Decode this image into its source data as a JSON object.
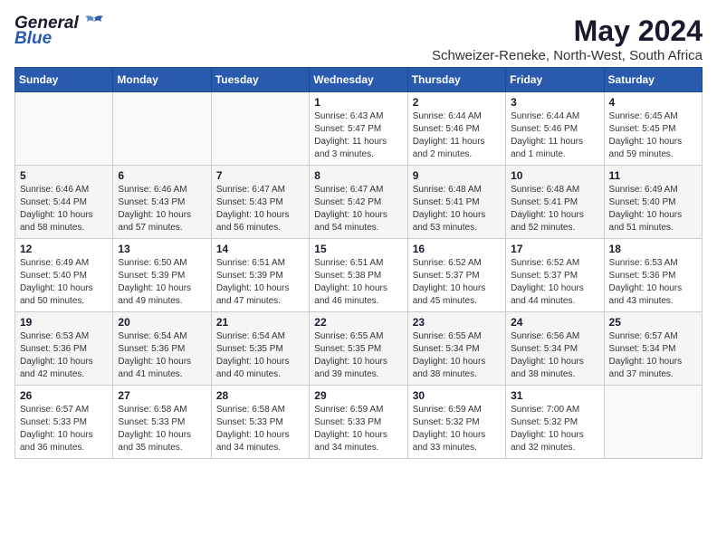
{
  "logo": {
    "general": "General",
    "blue": "Blue"
  },
  "title": "May 2024",
  "subtitle": "Schweizer-Reneke, North-West, South Africa",
  "days_of_week": [
    "Sunday",
    "Monday",
    "Tuesday",
    "Wednesday",
    "Thursday",
    "Friday",
    "Saturday"
  ],
  "weeks": [
    {
      "cells": [
        {
          "day": null,
          "info": null
        },
        {
          "day": null,
          "info": null
        },
        {
          "day": null,
          "info": null
        },
        {
          "day": "1",
          "info": "Sunrise: 6:43 AM\nSunset: 5:47 PM\nDaylight: 11 hours\nand 3 minutes."
        },
        {
          "day": "2",
          "info": "Sunrise: 6:44 AM\nSunset: 5:46 PM\nDaylight: 11 hours\nand 2 minutes."
        },
        {
          "day": "3",
          "info": "Sunrise: 6:44 AM\nSunset: 5:46 PM\nDaylight: 11 hours\nand 1 minute."
        },
        {
          "day": "4",
          "info": "Sunrise: 6:45 AM\nSunset: 5:45 PM\nDaylight: 10 hours\nand 59 minutes."
        }
      ],
      "alt": false
    },
    {
      "cells": [
        {
          "day": "5",
          "info": "Sunrise: 6:46 AM\nSunset: 5:44 PM\nDaylight: 10 hours\nand 58 minutes."
        },
        {
          "day": "6",
          "info": "Sunrise: 6:46 AM\nSunset: 5:43 PM\nDaylight: 10 hours\nand 57 minutes."
        },
        {
          "day": "7",
          "info": "Sunrise: 6:47 AM\nSunset: 5:43 PM\nDaylight: 10 hours\nand 56 minutes."
        },
        {
          "day": "8",
          "info": "Sunrise: 6:47 AM\nSunset: 5:42 PM\nDaylight: 10 hours\nand 54 minutes."
        },
        {
          "day": "9",
          "info": "Sunrise: 6:48 AM\nSunset: 5:41 PM\nDaylight: 10 hours\nand 53 minutes."
        },
        {
          "day": "10",
          "info": "Sunrise: 6:48 AM\nSunset: 5:41 PM\nDaylight: 10 hours\nand 52 minutes."
        },
        {
          "day": "11",
          "info": "Sunrise: 6:49 AM\nSunset: 5:40 PM\nDaylight: 10 hours\nand 51 minutes."
        }
      ],
      "alt": true
    },
    {
      "cells": [
        {
          "day": "12",
          "info": "Sunrise: 6:49 AM\nSunset: 5:40 PM\nDaylight: 10 hours\nand 50 minutes."
        },
        {
          "day": "13",
          "info": "Sunrise: 6:50 AM\nSunset: 5:39 PM\nDaylight: 10 hours\nand 49 minutes."
        },
        {
          "day": "14",
          "info": "Sunrise: 6:51 AM\nSunset: 5:39 PM\nDaylight: 10 hours\nand 47 minutes."
        },
        {
          "day": "15",
          "info": "Sunrise: 6:51 AM\nSunset: 5:38 PM\nDaylight: 10 hours\nand 46 minutes."
        },
        {
          "day": "16",
          "info": "Sunrise: 6:52 AM\nSunset: 5:37 PM\nDaylight: 10 hours\nand 45 minutes."
        },
        {
          "day": "17",
          "info": "Sunrise: 6:52 AM\nSunset: 5:37 PM\nDaylight: 10 hours\nand 44 minutes."
        },
        {
          "day": "18",
          "info": "Sunrise: 6:53 AM\nSunset: 5:36 PM\nDaylight: 10 hours\nand 43 minutes."
        }
      ],
      "alt": false
    },
    {
      "cells": [
        {
          "day": "19",
          "info": "Sunrise: 6:53 AM\nSunset: 5:36 PM\nDaylight: 10 hours\nand 42 minutes."
        },
        {
          "day": "20",
          "info": "Sunrise: 6:54 AM\nSunset: 5:36 PM\nDaylight: 10 hours\nand 41 minutes."
        },
        {
          "day": "21",
          "info": "Sunrise: 6:54 AM\nSunset: 5:35 PM\nDaylight: 10 hours\nand 40 minutes."
        },
        {
          "day": "22",
          "info": "Sunrise: 6:55 AM\nSunset: 5:35 PM\nDaylight: 10 hours\nand 39 minutes."
        },
        {
          "day": "23",
          "info": "Sunrise: 6:55 AM\nSunset: 5:34 PM\nDaylight: 10 hours\nand 38 minutes."
        },
        {
          "day": "24",
          "info": "Sunrise: 6:56 AM\nSunset: 5:34 PM\nDaylight: 10 hours\nand 38 minutes."
        },
        {
          "day": "25",
          "info": "Sunrise: 6:57 AM\nSunset: 5:34 PM\nDaylight: 10 hours\nand 37 minutes."
        }
      ],
      "alt": true
    },
    {
      "cells": [
        {
          "day": "26",
          "info": "Sunrise: 6:57 AM\nSunset: 5:33 PM\nDaylight: 10 hours\nand 36 minutes."
        },
        {
          "day": "27",
          "info": "Sunrise: 6:58 AM\nSunset: 5:33 PM\nDaylight: 10 hours\nand 35 minutes."
        },
        {
          "day": "28",
          "info": "Sunrise: 6:58 AM\nSunset: 5:33 PM\nDaylight: 10 hours\nand 34 minutes."
        },
        {
          "day": "29",
          "info": "Sunrise: 6:59 AM\nSunset: 5:33 PM\nDaylight: 10 hours\nand 34 minutes."
        },
        {
          "day": "30",
          "info": "Sunrise: 6:59 AM\nSunset: 5:32 PM\nDaylight: 10 hours\nand 33 minutes."
        },
        {
          "day": "31",
          "info": "Sunrise: 7:00 AM\nSunset: 5:32 PM\nDaylight: 10 hours\nand 32 minutes."
        },
        {
          "day": null,
          "info": null
        }
      ],
      "alt": false
    }
  ]
}
